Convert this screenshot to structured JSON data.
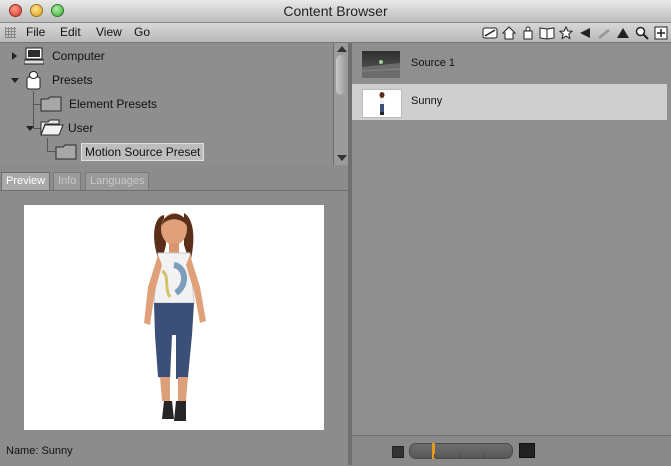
{
  "window": {
    "title": "Content Browser"
  },
  "menu": {
    "items": [
      "File",
      "Edit",
      "View",
      "Go"
    ]
  },
  "toolbar": {
    "icons": [
      "content-browse-icon",
      "home-icon",
      "figure-icon",
      "library-book-icon",
      "favorite-star-icon",
      "back-arrow-icon",
      "forward-arrow-icon",
      "up-arrow-icon",
      "search-icon",
      "add-icon"
    ]
  },
  "tree": {
    "nodes": [
      {
        "label": "Computer"
      },
      {
        "label": "Presets"
      },
      {
        "label": "Element Presets"
      },
      {
        "label": "User"
      },
      {
        "label": "Motion Source Preset"
      }
    ]
  },
  "tabs": [
    {
      "label": "Preview"
    },
    {
      "label": "Info"
    },
    {
      "label": "Languages"
    }
  ],
  "preview": {
    "name_label": "Name:",
    "name_value": "Sunny"
  },
  "items": [
    {
      "label": "Source 1",
      "selected": false
    },
    {
      "label": "Sunny",
      "selected": true
    }
  ],
  "footer": {
    "thumbnail_size": 0.22
  }
}
